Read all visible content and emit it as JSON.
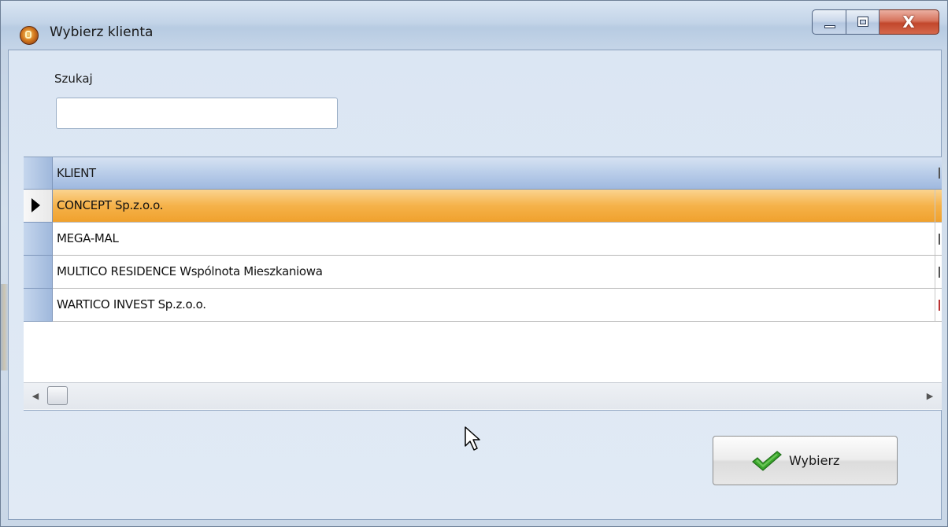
{
  "window": {
    "title": "Wybierz klienta",
    "controls": {
      "minimize": "minimize",
      "maximize": "maximize",
      "close": "X"
    }
  },
  "search": {
    "label": "Szukaj",
    "value": "",
    "placeholder": ""
  },
  "grid": {
    "columns": [
      "KLIENT"
    ],
    "rows": [
      {
        "klient": "CONCEPT Sp.z.o.o.",
        "selected": true
      },
      {
        "klient": "MEGA-MAL",
        "selected": false
      },
      {
        "klient": "MULTICO RESIDENCE Wspólnota Mieszkaniowa",
        "selected": false
      },
      {
        "klient": "WARTICO INVEST Sp.z.o.o.",
        "selected": false
      }
    ],
    "scroll_left_icon": "arrow-left-icon",
    "scroll_right_icon": "arrow-right-icon"
  },
  "actions": {
    "select_label": "Wybierz",
    "select_icon": "checkmark-icon"
  },
  "colors": {
    "selected_row": "#f5b24a",
    "header": "#b9cde9",
    "close_button": "#c2472c",
    "check_green": "#3aa52c"
  }
}
